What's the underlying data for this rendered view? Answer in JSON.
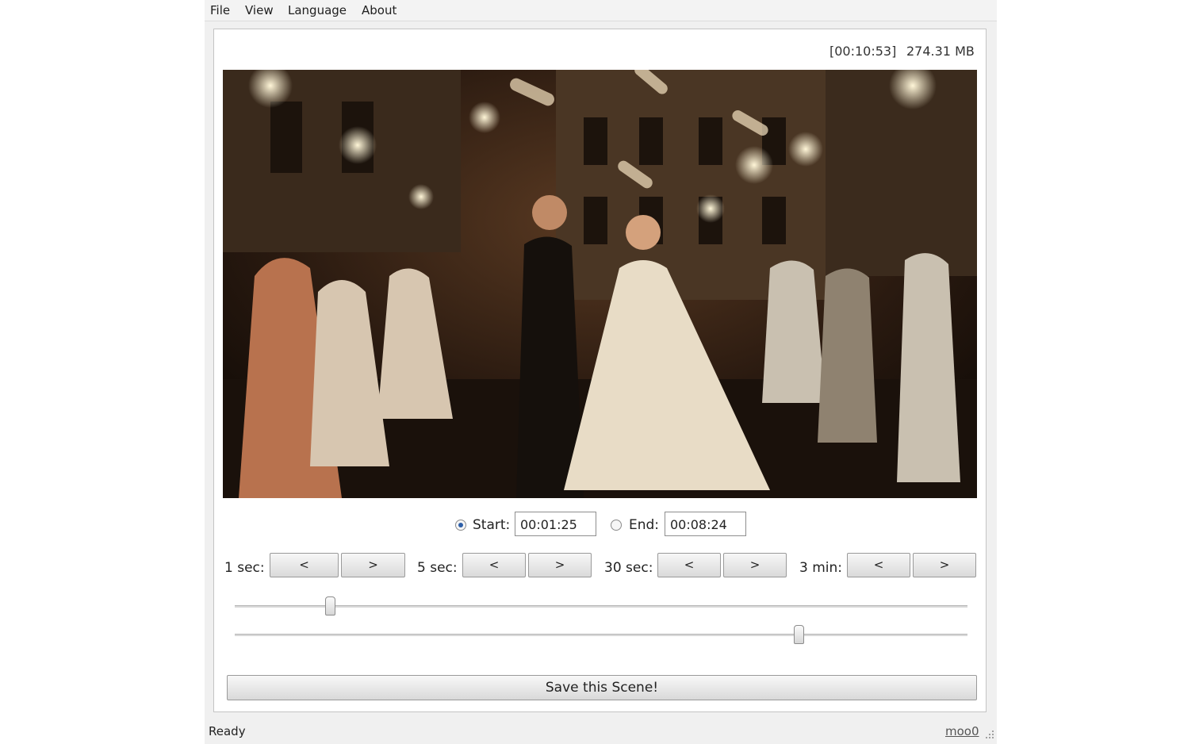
{
  "menu": {
    "file": "File",
    "view": "View",
    "language": "Language",
    "about": "About"
  },
  "info": {
    "duration": "[00:10:53]",
    "filesize": "274.31 MB"
  },
  "video": {
    "icon": "video-frame-preview"
  },
  "range": {
    "start_label": "Start:",
    "start_value": "00:01:25",
    "end_label": "End:",
    "end_value": "00:08:24",
    "selected": "start"
  },
  "steps": [
    {
      "label": "1 sec:",
      "back": "<",
      "forward": ">"
    },
    {
      "label": "5 sec:",
      "back": "<",
      "forward": ">"
    },
    {
      "label": "30 sec:",
      "back": "<",
      "forward": ">"
    },
    {
      "label": "3 min:",
      "back": "<",
      "forward": ">"
    }
  ],
  "sliders": {
    "start_fraction": 0.13,
    "end_fraction": 0.77
  },
  "save_button": "Save this Scene!",
  "status": {
    "text": "Ready",
    "link": "moo0"
  }
}
